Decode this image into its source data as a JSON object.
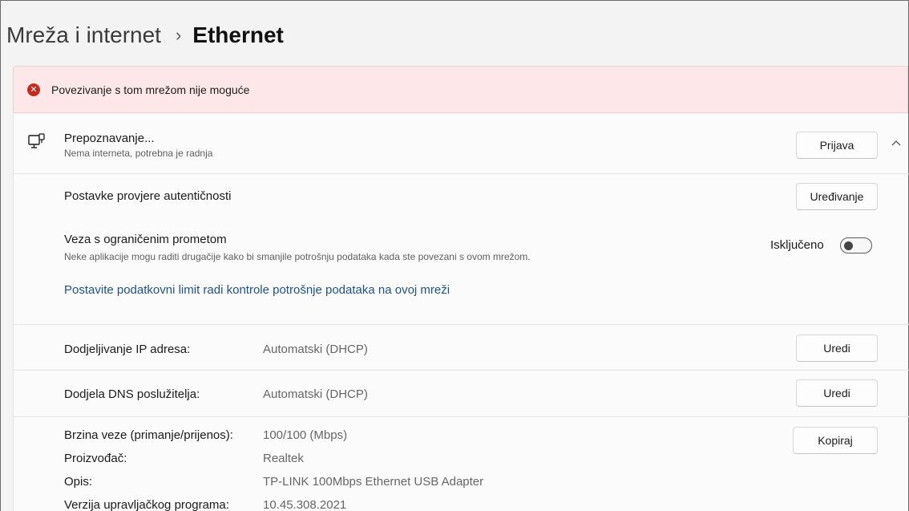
{
  "breadcrumb": {
    "parent": "Mreža i internet",
    "separator": "›",
    "current": "Ethernet"
  },
  "error_bar": {
    "icon": "error-icon",
    "text": "Povezivanje s tom mrežom nije moguće"
  },
  "connection": {
    "icon": "ethernet-icon",
    "title": "Prepoznavanje...",
    "subtitle": "Nema interneta, potrebna je radnja",
    "button": "Prijava",
    "expand_icon": "chevron-up-icon"
  },
  "auth": {
    "label": "Postavke provjere autentičnosti",
    "button": "Uređivanje"
  },
  "metered": {
    "title": "Veza s ograničenim prometom",
    "subtitle": "Neke aplikacije mogu raditi drugačije kako bi smanjile potrošnju podataka kada ste povezani s ovom mrežom.",
    "toggle_label": "Isključeno",
    "toggle_on": false,
    "link": "Postavite podatkovni limit radi kontrole potrošnje podataka na ovoj mreži"
  },
  "ip": {
    "label": "Dodjeljivanje IP adresa:",
    "value": "Automatski (DHCP)",
    "button": "Uredi"
  },
  "dns": {
    "label": "Dodjela DNS poslužitelja:",
    "value": "Automatski (DHCP)",
    "button": "Uredi"
  },
  "properties": {
    "button": "Kopiraj",
    "items": [
      {
        "label": "Brzina veze (primanje/prijenos):",
        "value": "100/100 (Mbps)"
      },
      {
        "label": "Proizvođač:",
        "value": "Realtek"
      },
      {
        "label": "Opis:",
        "value": "TP-LINK 100Mbps Ethernet USB Adapter"
      },
      {
        "label": "Verzija upravljačkog programa:",
        "value": "10.45.308.2021"
      }
    ]
  }
}
